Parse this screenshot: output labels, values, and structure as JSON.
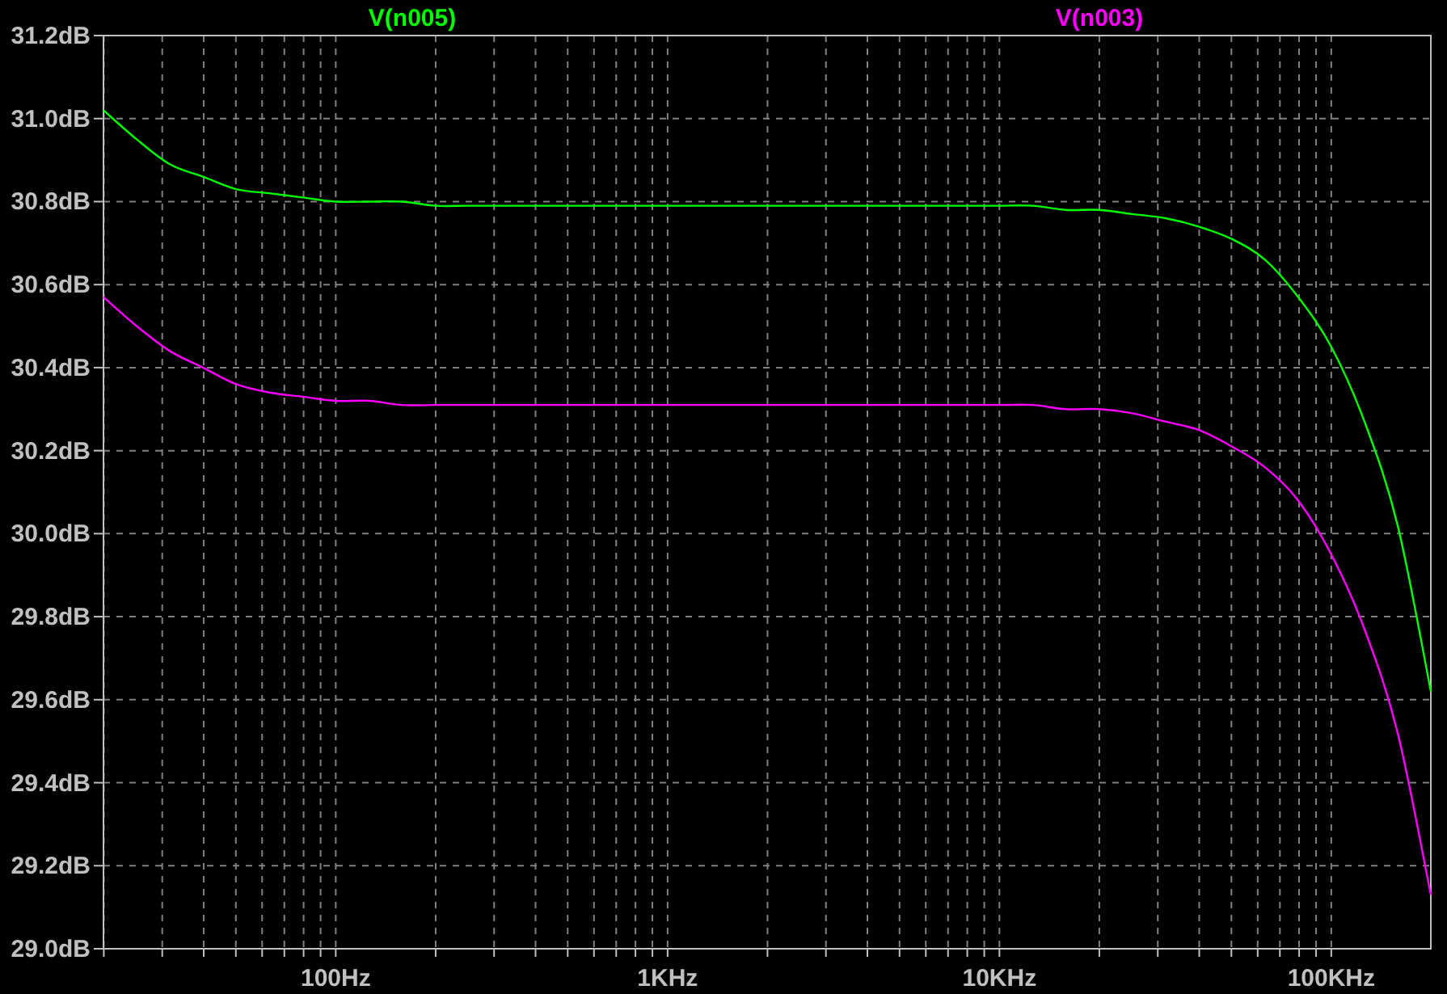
{
  "plot": {
    "chart_data": {
      "type": "line",
      "grid": true,
      "categories": [
        null,
        null,
        null,
        null,
        null,
        null,
        null,
        "100Hz",
        null,
        null,
        null,
        null,
        null,
        null,
        null,
        null,
        null,
        "1KHz",
        null,
        null,
        null,
        null,
        null,
        null,
        null,
        null,
        null,
        "10KHz",
        null,
        null,
        null,
        null,
        null,
        null,
        null,
        null,
        null,
        "100KHz",
        null,
        null,
        null
      ],
      "series": [
        {
          "name": "V(n005)",
          "color": "#00ff00",
          "values": [
            31.02,
            30.95,
            30.89,
            30.86,
            30.83,
            30.82,
            30.81,
            30.8,
            30.8,
            30.8,
            30.79,
            30.79,
            30.79,
            30.79,
            30.79,
            30.79,
            30.79,
            30.79,
            30.79,
            30.79,
            30.79,
            30.79,
            30.79,
            30.79,
            30.79,
            30.79,
            30.79,
            30.79,
            30.79,
            30.78,
            30.78,
            30.77,
            30.76,
            30.74,
            30.71,
            30.66,
            30.57,
            30.45,
            30.27,
            30.02,
            29.62
          ]
        },
        {
          "name": "V(n003)",
          "color": "#ff00ff",
          "values": [
            30.57,
            30.5,
            30.44,
            30.4,
            30.36,
            30.34,
            30.33,
            30.32,
            30.32,
            30.31,
            30.31,
            30.31,
            30.31,
            30.31,
            30.31,
            30.31,
            30.31,
            30.31,
            30.31,
            30.31,
            30.31,
            30.31,
            30.31,
            30.31,
            30.31,
            30.31,
            30.31,
            30.31,
            30.31,
            30.3,
            30.3,
            30.29,
            30.27,
            30.25,
            30.21,
            30.16,
            30.08,
            29.95,
            29.77,
            29.52,
            29.13
          ]
        }
      ],
      "ylim": [
        29.0,
        31.2
      ],
      "yticks": [
        {
          "value": 29.0,
          "label": "29.0dB"
        },
        {
          "value": 29.2,
          "label": "29.2dB"
        },
        {
          "value": 29.4,
          "label": "29.4dB"
        },
        {
          "value": 29.6,
          "label": "29.6dB"
        },
        {
          "value": 29.8,
          "label": "29.8dB"
        },
        {
          "value": 30.0,
          "label": "30.0dB"
        },
        {
          "value": 30.2,
          "label": "30.2dB"
        },
        {
          "value": 30.4,
          "label": "30.4dB"
        },
        {
          "value": 30.6,
          "label": "30.6dB"
        },
        {
          "value": 30.8,
          "label": "30.8dB"
        },
        {
          "value": 31.0,
          "label": "31.0dB"
        },
        {
          "value": 31.2,
          "label": "31.2dB"
        }
      ]
    }
  }
}
